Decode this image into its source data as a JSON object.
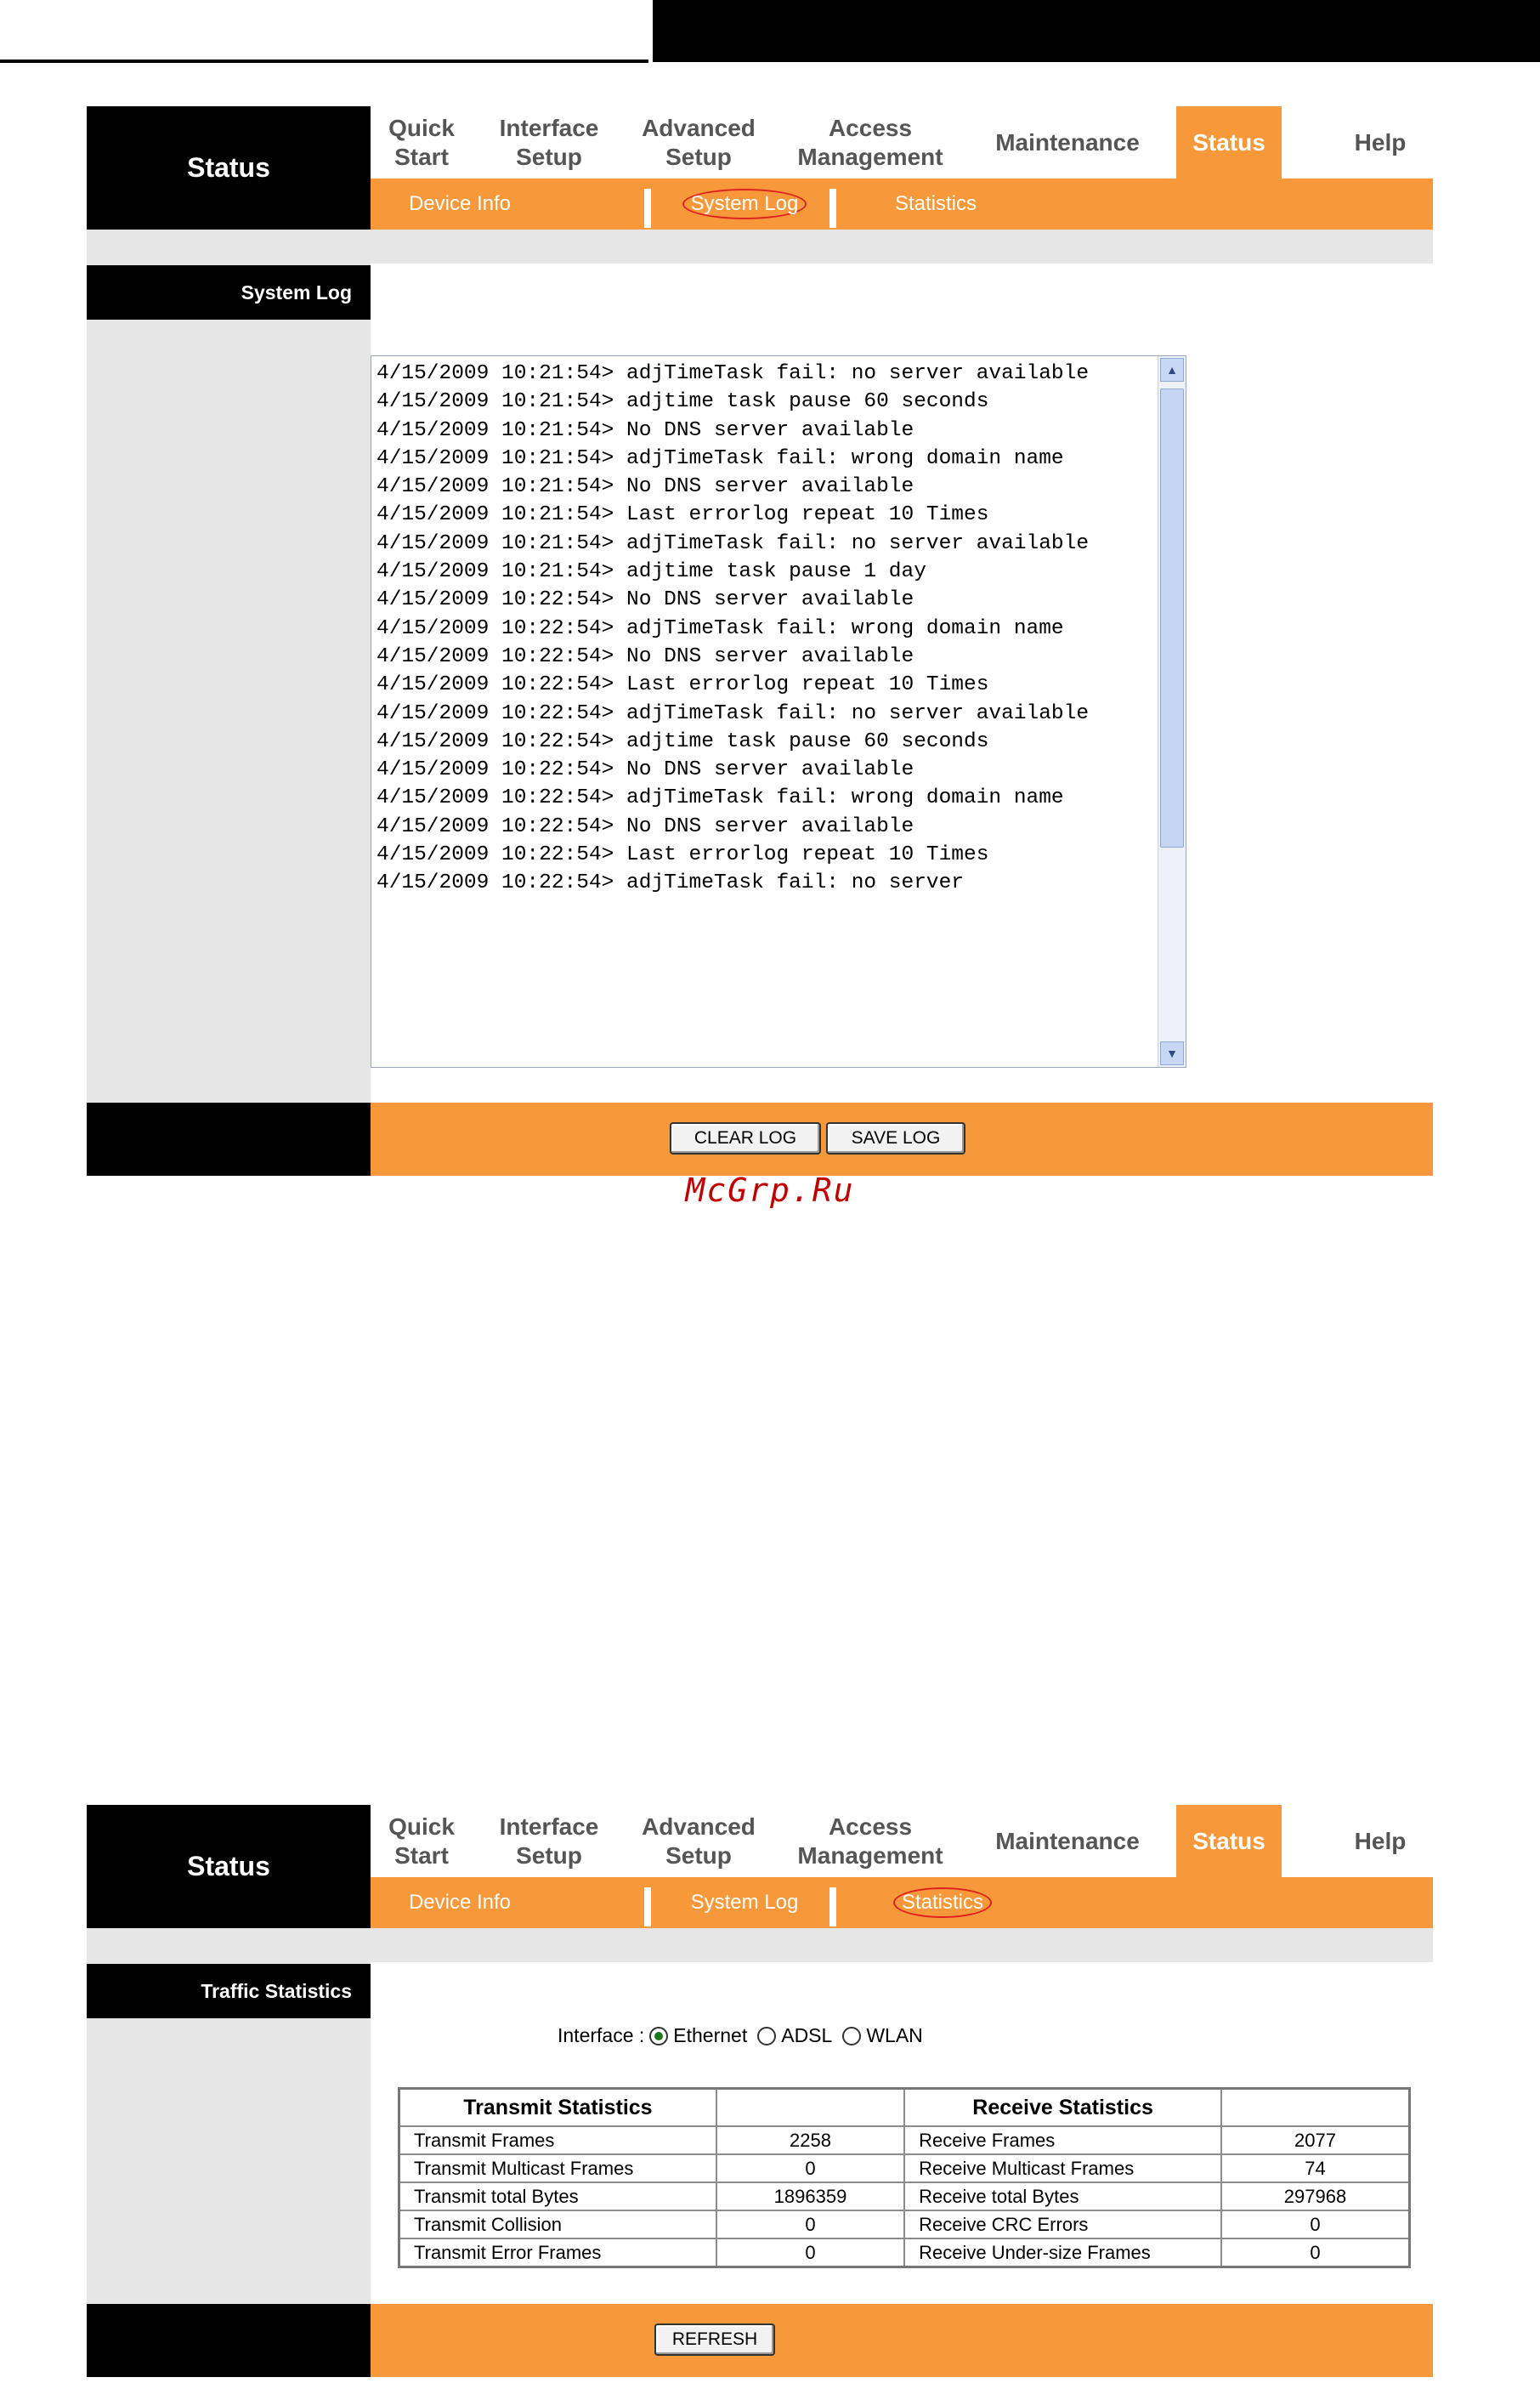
{
  "screens": [
    {
      "brand": "Status",
      "nav": [
        {
          "label": "Quick\nStart"
        },
        {
          "label": "Interface\nSetup"
        },
        {
          "label": "Advanced\nSetup"
        },
        {
          "label": "Access\nManagement"
        },
        {
          "label": "Maintenance"
        },
        {
          "label": "Status",
          "active": true
        },
        {
          "label": "Help"
        }
      ],
      "subnav": [
        {
          "label": "Device Info"
        },
        {
          "label": "System Log",
          "circled": true
        },
        {
          "label": "Statistics"
        }
      ],
      "section_title": "System Log",
      "log_lines": [
        "4/15/2009 10:21:54> adjTimeTask fail: no server available",
        "4/15/2009 10:21:54> adjtime task pause 60 seconds",
        "4/15/2009 10:21:54> No DNS server available",
        "4/15/2009 10:21:54> adjTimeTask fail: wrong domain name",
        "4/15/2009 10:21:54> No DNS server available",
        "4/15/2009 10:21:54> Last errorlog repeat 10 Times",
        "4/15/2009 10:21:54> adjTimeTask fail: no server available",
        "4/15/2009 10:21:54> adjtime task pause 1 day",
        "4/15/2009 10:22:54> No DNS server available",
        "4/15/2009 10:22:54> adjTimeTask fail: wrong domain name",
        "4/15/2009 10:22:54> No DNS server available",
        "4/15/2009 10:22:54> Last errorlog repeat 10 Times",
        "4/15/2009 10:22:54> adjTimeTask fail: no server available",
        "4/15/2009 10:22:54> adjtime task pause 60 seconds",
        "4/15/2009 10:22:54> No DNS server available",
        "4/15/2009 10:22:54> adjTimeTask fail: wrong domain name",
        "4/15/2009 10:22:54> No DNS server available",
        "4/15/2009 10:22:54> Last errorlog repeat 10 Times",
        "4/15/2009 10:22:54> adjTimeTask fail: no server"
      ],
      "buttons": {
        "clear": "CLEAR LOG",
        "save": "SAVE LOG"
      }
    },
    {
      "brand": "Status",
      "nav": [
        {
          "label": "Quick\nStart"
        },
        {
          "label": "Interface\nSetup"
        },
        {
          "label": "Advanced\nSetup"
        },
        {
          "label": "Access\nManagement"
        },
        {
          "label": "Maintenance"
        },
        {
          "label": "Status",
          "active": true
        },
        {
          "label": "Help"
        }
      ],
      "subnav": [
        {
          "label": "Device Info"
        },
        {
          "label": "System Log"
        },
        {
          "label": "Statistics",
          "circled": true
        }
      ],
      "section_title": "Traffic Statistics",
      "interface": {
        "label": "Interface :",
        "options": [
          "Ethernet",
          "ADSL",
          "WLAN"
        ],
        "selected": "Ethernet"
      },
      "transmit_header": "Transmit Statistics",
      "receive_header": "Receive Statistics",
      "rows": [
        {
          "t_label": "Transmit Frames",
          "t_val": "2258",
          "r_label": "Receive Frames",
          "r_val": "2077"
        },
        {
          "t_label": "Transmit Multicast Frames",
          "t_val": "0",
          "r_label": "Receive Multicast Frames",
          "r_val": "74"
        },
        {
          "t_label": "Transmit total Bytes",
          "t_val": "1896359",
          "r_label": "Receive total Bytes",
          "r_val": "297968"
        },
        {
          "t_label": "Transmit Collision",
          "t_val": "0",
          "r_label": "Receive CRC Errors",
          "r_val": "0"
        },
        {
          "t_label": "Transmit Error Frames",
          "t_val": "0",
          "r_label": "Receive Under-size Frames",
          "r_val": "0"
        }
      ],
      "buttons": {
        "refresh": "REFRESH"
      }
    }
  ],
  "watermark": "McGrp.Ru",
  "colors": {
    "accent": "#f7993a",
    "black": "#000000",
    "grey": "#e6e6e6"
  }
}
